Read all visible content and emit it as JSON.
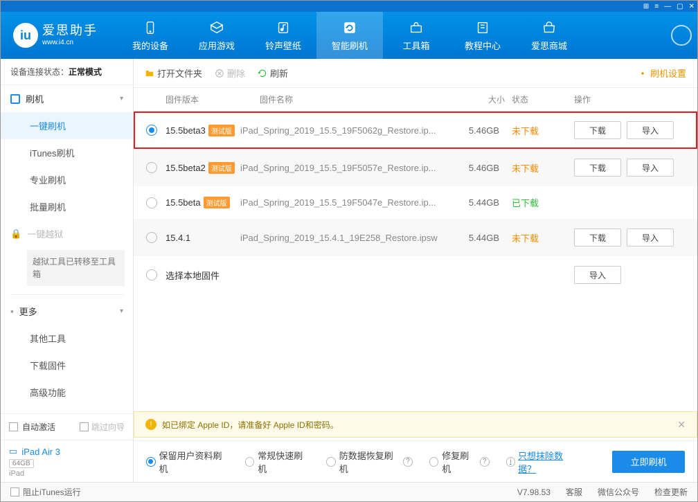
{
  "titlebar": {
    "icons": [
      "grid",
      "list",
      "min",
      "max",
      "close"
    ]
  },
  "logo": {
    "cn": "爱思助手",
    "en": "www.i4.cn"
  },
  "nav": [
    {
      "label": "我的设备",
      "icon": "phone"
    },
    {
      "label": "应用游戏",
      "icon": "apps"
    },
    {
      "label": "铃声壁纸",
      "icon": "music"
    },
    {
      "label": "智能刷机",
      "icon": "refresh",
      "active": true
    },
    {
      "label": "工具箱",
      "icon": "toolbox"
    },
    {
      "label": "教程中心",
      "icon": "book"
    },
    {
      "label": "爱思商城",
      "icon": "shop"
    }
  ],
  "sidebar": {
    "status_label": "设备连接状态：",
    "status_value": "正常模式",
    "flash_head": "刷机",
    "flash_items": [
      "一键刷机",
      "iTunes刷机",
      "专业刷机",
      "批量刷机"
    ],
    "jailbreak": "一键越狱",
    "jailbreak_note": "越狱工具已转移至工具箱",
    "more_head": "更多",
    "more_items": [
      "其他工具",
      "下载固件",
      "高级功能"
    ],
    "auto_activate": "自动激活",
    "skip_guide": "跳过向导",
    "device": {
      "name": "iPad Air 3",
      "capacity": "64GB",
      "type": "iPad"
    }
  },
  "toolbar": {
    "open": "打开文件夹",
    "delete": "删除",
    "refresh": "刷新",
    "settings": "刷机设置"
  },
  "columns": {
    "ver": "固件版本",
    "name": "固件名称",
    "size": "大小",
    "status": "状态",
    "action": "操作"
  },
  "firmwares": [
    {
      "ver": "15.5beta3",
      "beta": "测试版",
      "name": "iPad_Spring_2019_15.5_19F5062g_Restore.ip...",
      "size": "5.46GB",
      "status": "未下载",
      "status_class": "not",
      "selected": true,
      "highlight": true,
      "buttons": [
        "下载",
        "导入"
      ]
    },
    {
      "ver": "15.5beta2",
      "beta": "测试版",
      "name": "iPad_Spring_2019_15.5_19F5057e_Restore.ip...",
      "size": "5.46GB",
      "status": "未下载",
      "status_class": "not",
      "buttons": [
        "下载",
        "导入"
      ]
    },
    {
      "ver": "15.5beta",
      "beta": "测试版",
      "name": "iPad_Spring_2019_15.5_19F5047e_Restore.ip...",
      "size": "5.44GB",
      "status": "已下载",
      "status_class": "done",
      "buttons": []
    },
    {
      "ver": "15.4.1",
      "name": "iPad_Spring_2019_15.4.1_19E258_Restore.ipsw",
      "size": "5.44GB",
      "status": "未下载",
      "status_class": "not",
      "buttons": [
        "下载",
        "导入"
      ]
    },
    {
      "ver": "",
      "local": true,
      "name_override": "选择本地固件",
      "buttons": [
        "导入"
      ]
    }
  ],
  "info_banner": "如已绑定 Apple ID，请准备好 Apple ID和密码。",
  "options": [
    {
      "label": "保留用户资料刷机",
      "active": true
    },
    {
      "label": "常规快速刷机"
    },
    {
      "label": "防数据恢复刷机",
      "help": true
    },
    {
      "label": "修复刷机",
      "help": true
    }
  ],
  "erase_link": "只想抹除数据？",
  "flash_now": "立即刷机",
  "footer": {
    "block_itunes": "阻止iTunes运行",
    "version": "V7.98.53",
    "links": [
      "客服",
      "微信公众号",
      "检查更新"
    ]
  }
}
